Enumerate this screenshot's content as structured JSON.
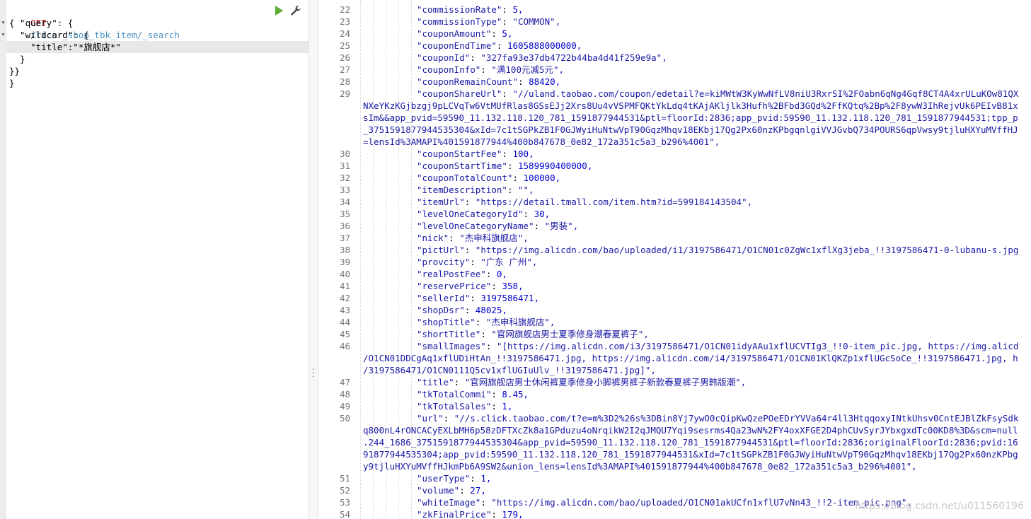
{
  "request": {
    "method": "GET",
    "path": "/ricer_shop_tbk_item/_search",
    "lines": [
      "{ \"query\": {",
      "  \"wildcard\": {",
      "    \"title\":\"*旗舰店*\"",
      "  }",
      "}}",
      "}"
    ]
  },
  "response": {
    "lines": [
      {
        "n": "22",
        "text": "\"commissionRate\": 5,"
      },
      {
        "n": "23",
        "text": "\"commissionType\": \"COMMON\","
      },
      {
        "n": "24",
        "text": "\"couponAmount\": 5,"
      },
      {
        "n": "25",
        "text": "\"couponEndTime\": 1605888000000,"
      },
      {
        "n": "26",
        "text": "\"couponId\": \"327fa93e37db4722b44ba4d41f259e9a\","
      },
      {
        "n": "27",
        "text": "\"couponInfo\": \"满100元减5元\","
      },
      {
        "n": "28",
        "text": "\"couponRemainCount\": 88420,"
      },
      {
        "n": "29",
        "text": "\"couponShareUrl\": \"//uland.taobao.com/coupon/edetail?e=kiMWtW3KyWwNfLV8niU3RxrSI%2FOabn6qNg4Gqf8CT4A4xrULuKOw81QX"
      },
      {
        "n": "",
        "text": "NXeYKzKGjbzgj9pLCVqTw6VtMUfRlas8GSsEJj2Xrs8Uu4vVSPMFQKtYkLdq4tKAjAKljlk3Hufh%2BFbd3GQd%2FfKQtq%2Bp%2F8ywW3IhRejvUk6PEIvB81x"
      },
      {
        "n": "",
        "text": "sIm&&app_pvid=59590_11.132.118.120_781_1591877944531&ptl=floorId:2836;app_pvid:59590_11.132.118.120_781_1591877944531;tpp_p"
      },
      {
        "n": "",
        "text": "_3751591877944535304&xId=7c1tSGPkZB1F0GJWyiHuNtwVpT90GqzMhqv18EKbj17Qg2Px60nzKPbgqnlgiVVJGvbQ734POURS6qpVwsy9tjluHXYuMVffHJ"
      },
      {
        "n": "",
        "text": "=lensId%3AMAPI%401591877944%400b847678_0e82_172a351c5a3_b296%4001\","
      },
      {
        "n": "30",
        "text": "\"couponStartFee\": 100,"
      },
      {
        "n": "31",
        "text": "\"couponStartTime\": 1589990400000,"
      },
      {
        "n": "32",
        "text": "\"couponTotalCount\": 100000,"
      },
      {
        "n": "33",
        "text": "\"itemDescription\": \"\","
      },
      {
        "n": "34",
        "text": "\"itemUrl\": \"https://detail.tmall.com/item.htm?id=599184143504\","
      },
      {
        "n": "35",
        "text": "\"levelOneCategoryId\": 30,"
      },
      {
        "n": "36",
        "text": "\"levelOneCategoryName\": \"男装\","
      },
      {
        "n": "37",
        "text": "\"nick\": \"杰申科旗舰店\","
      },
      {
        "n": "38",
        "text": "\"pictUrl\": \"https://img.alicdn.com/bao/uploaded/i1/3197586471/O1CN01c0ZgWc1xflXg3jeba_!!3197586471-0-lubanu-s.jpg"
      },
      {
        "n": "39",
        "text": "\"provcity\": \"广东 广州\","
      },
      {
        "n": "40",
        "text": "\"realPostFee\": 0,"
      },
      {
        "n": "41",
        "text": "\"reservePrice\": 358,"
      },
      {
        "n": "42",
        "text": "\"sellerId\": 3197586471,"
      },
      {
        "n": "43",
        "text": "\"shopDsr\": 48025,"
      },
      {
        "n": "44",
        "text": "\"shopTitle\": \"杰申科旗舰店\","
      },
      {
        "n": "45",
        "text": "\"shortTitle\": \"官网旗舰店男士夏季修身潮春夏裤子\","
      },
      {
        "n": "46",
        "text": "\"smallImages\": \"[https://img.alicdn.com/i3/3197586471/O1CN01idyAAu1xflUCVTIg3_!!0-item_pic.jpg, https://img.alicd"
      },
      {
        "n": "",
        "text": "/O1CN01DDCgAq1xflUDiHtAn_!!3197586471.jpg, https://img.alicdn.com/i4/3197586471/O1CN01KlQKZp1xflUGcSoCe_!!3197586471.jpg, h"
      },
      {
        "n": "",
        "text": "/3197586471/O1CN0111Q5cv1xflUGIuUlv_!!3197586471.jpg]\","
      },
      {
        "n": "47",
        "text": "\"title\": \"官网旗舰店男士休闲裤夏季修身小脚裤男裤子新款春夏裤子男韩版潮\","
      },
      {
        "n": "48",
        "text": "\"tkTotalCommi\": 8.45,"
      },
      {
        "n": "49",
        "text": "\"tkTotalSales\": 1,"
      },
      {
        "n": "50",
        "text": "\"url\": \"//s.click.taobao.com/t?e=m%3D2%26s%3DBin8Yj7ywO0cQipKwQzePOeEDrYVVa64r4ll3HtqqoxyINtkUhsv0CntEJBlZkFsySdk"
      },
      {
        "n": "",
        "text": "q800nL4rONCACyEXLbMH6p58zDFTXcZk8a1GPduzu4oNrqikW2I2qJMQU7Yqi9sesrms4Qa23wN%2FY4oxXFGE2D4phCUvSyrJYbxgxdTc00KD8%3D&scm=null"
      },
      {
        "n": "",
        "text": ".244_1686_3751591877944535304&app_pvid=59590_11.132.118.120_781_1591877944531&ptl=floorId:2836;originalFloorId:2836;pvid:16"
      },
      {
        "n": "",
        "text": "91877944535304;app_pvid:59590_11.132.118.120_781_1591877944531&xId=7c1tSGPkZB1F0GJWyiHuNtwVpT90GqzMhqv18EKbj17Qg2Px60nzKPbg"
      },
      {
        "n": "",
        "text": "y9tjluHXYuMVffHJkmPb6A9SW2&union_lens=lensId%3AMAPI%401591877944%400b847678_0e82_172a351c5a3_b296%4001\","
      },
      {
        "n": "51",
        "text": "\"userType\": 1,"
      },
      {
        "n": "52",
        "text": "\"volume\": 27,"
      },
      {
        "n": "53",
        "text": "\"whiteImage\": \"https://img.alicdn.com/bao/uploaded/O1CN01akUCfn1xflU7vNn43_!!2-item_pic.png\","
      },
      {
        "n": "54",
        "text": "\"zkFinalPrice\": 179,"
      }
    ]
  },
  "watermark": "https://blog.csdn.net/u011560196",
  "icons": {
    "run": "play-icon",
    "settings": "wrench-icon",
    "divider": "vertical-dots-icon"
  },
  "colors": {
    "method": "#c5060b",
    "path": "#4a90c2",
    "string": "#1a1aa6",
    "number": "#0000cd",
    "gutter": "#ececec",
    "active_line": "#e8e8e8"
  }
}
